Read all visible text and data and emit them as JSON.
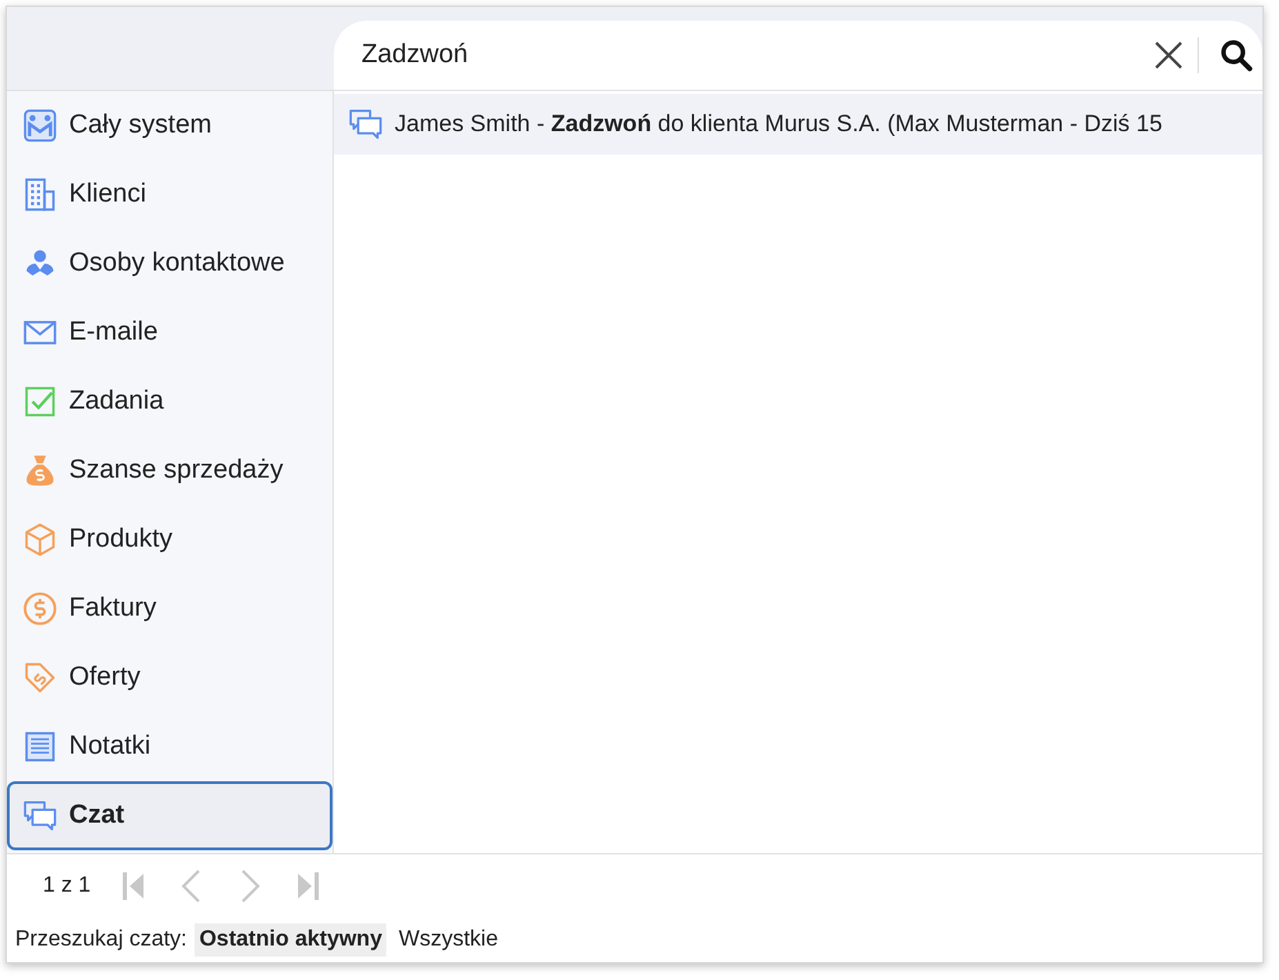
{
  "search": {
    "value": "Zadzwoń"
  },
  "sidebar": {
    "items": [
      {
        "label": "Cały system",
        "kind": "system",
        "selected": false
      },
      {
        "label": "Klienci",
        "kind": "building",
        "selected": false
      },
      {
        "label": "Osoby kontaktowe",
        "kind": "person",
        "selected": false
      },
      {
        "label": "E-maile",
        "kind": "mail",
        "selected": false
      },
      {
        "label": "Zadania",
        "kind": "check",
        "selected": false
      },
      {
        "label": "Szanse sprzedaży",
        "kind": "moneybag",
        "selected": false
      },
      {
        "label": "Produkty",
        "kind": "box",
        "selected": false
      },
      {
        "label": "Faktury",
        "kind": "dollar",
        "selected": false
      },
      {
        "label": "Oferty",
        "kind": "tag",
        "selected": false
      },
      {
        "label": "Notatki",
        "kind": "note",
        "selected": false
      },
      {
        "label": "Czat",
        "kind": "chat",
        "selected": true
      }
    ]
  },
  "results": [
    {
      "text": "James Smith - **Zadzwoń** do klienta Murus S.A. (Max Musterman - Dziś 15"
    }
  ],
  "pagination": {
    "label": "1 z 1",
    "buttons": [
      {
        "kind": "first",
        "disabled": true
      },
      {
        "kind": "prev",
        "disabled": true
      },
      {
        "kind": "next",
        "disabled": true
      },
      {
        "kind": "last",
        "disabled": true
      }
    ]
  },
  "filter": {
    "label": "Przeszukaj czaty:",
    "options": [
      {
        "label": "Ostatnio aktywny",
        "selected": true
      },
      {
        "label": "Wszystkie",
        "selected": false
      }
    ]
  }
}
